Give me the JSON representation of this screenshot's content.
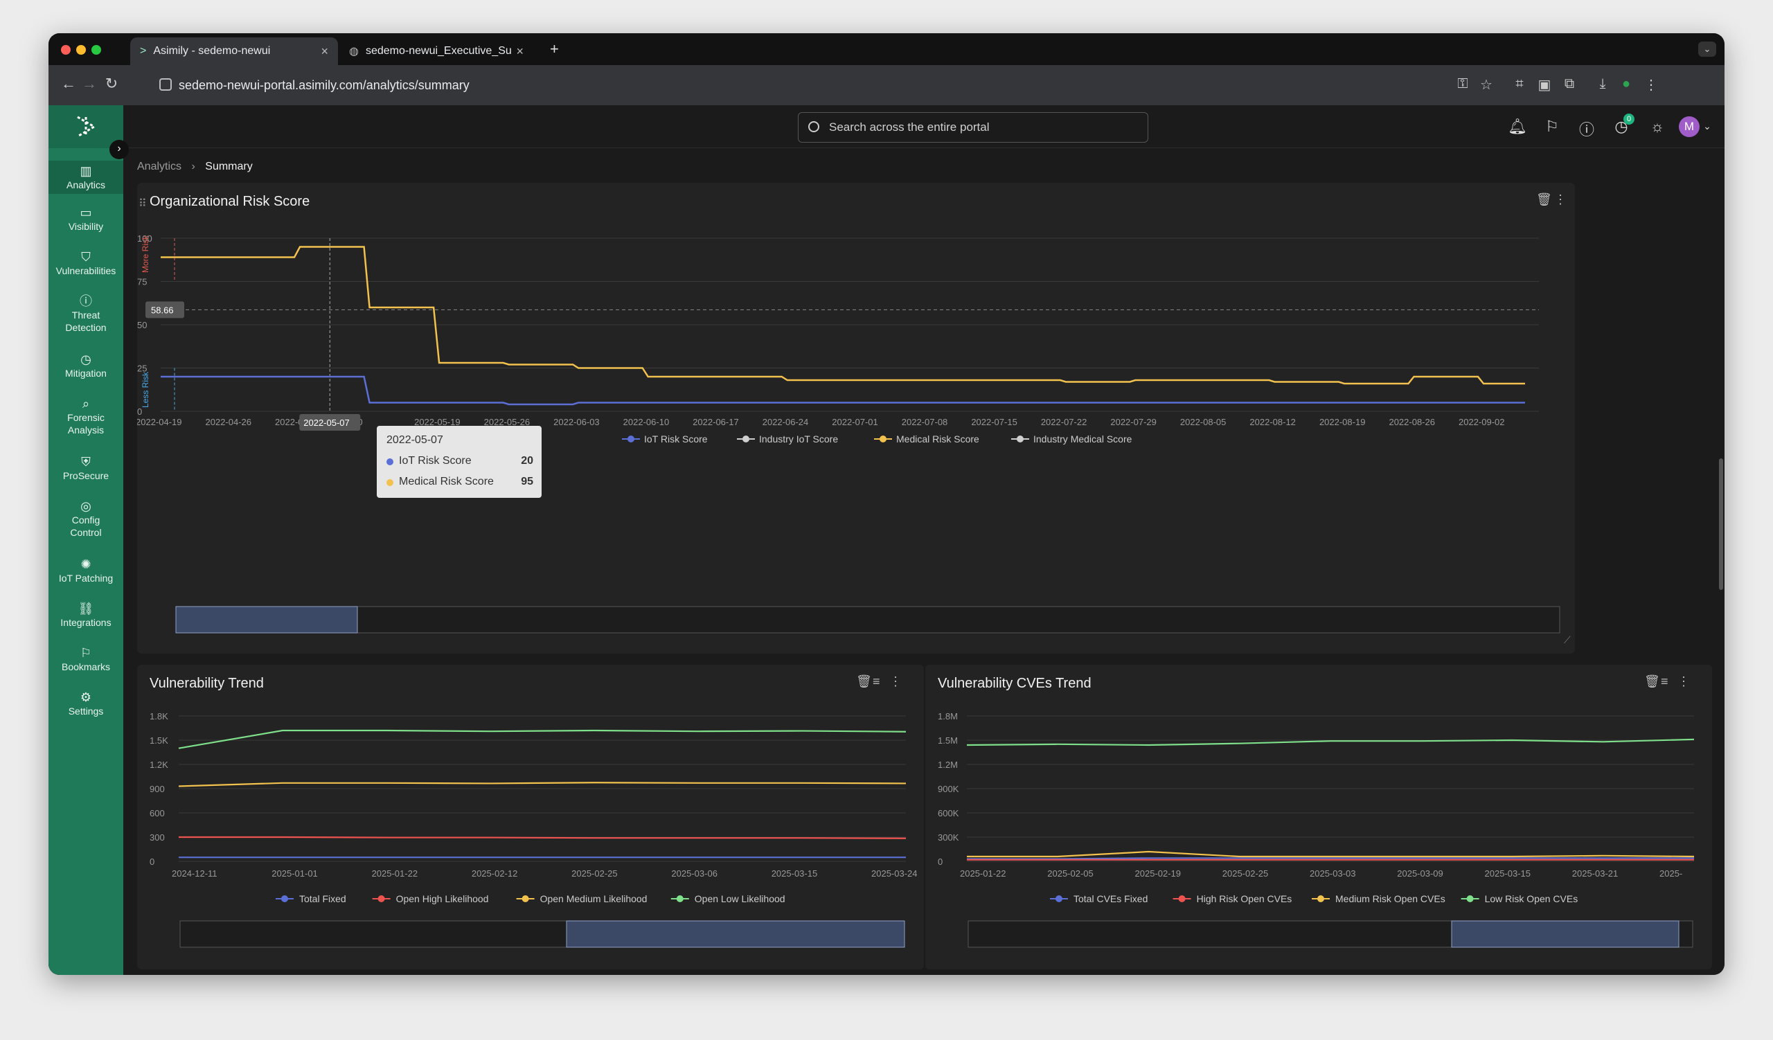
{
  "browser": {
    "tabs": [
      {
        "title": "Asimily - sedemo-newui",
        "active": true
      },
      {
        "title": "sedemo-newui_Executive_Su",
        "active": false
      }
    ],
    "new_tab": "+",
    "url": "sedemo-newui-portal.asimily.com/analytics/summary"
  },
  "app": {
    "search_placeholder": "Search across the entire portal",
    "notification_badge": "0",
    "avatar_initial": "M",
    "breadcrumb": {
      "parent": "Analytics",
      "current": "Summary"
    }
  },
  "sidebar": {
    "items": [
      {
        "label": "Analytics",
        "icon": "bar-chart-icon",
        "active": true
      },
      {
        "label": "Visibility",
        "icon": "monitor-icon"
      },
      {
        "label": "Vulnerabilities",
        "icon": "shield-icon"
      },
      {
        "label": "Threat Detection",
        "icon": "alert-icon"
      },
      {
        "label": "Mitigation",
        "icon": "clock-icon"
      },
      {
        "label": "Forensic Analysis",
        "icon": "search-icon"
      },
      {
        "label": "ProSecure",
        "icon": "shield-check-icon"
      },
      {
        "label": "Config Control",
        "icon": "cog-icon"
      },
      {
        "label": "IoT Patching",
        "icon": "patch-icon"
      },
      {
        "label": "Integrations",
        "icon": "link-icon"
      },
      {
        "label": "Bookmarks",
        "icon": "bookmark-icon"
      },
      {
        "label": "Settings",
        "icon": "gear-icon"
      }
    ]
  },
  "colors": {
    "accent": "#1f7a5a",
    "iot": "#5b6fd6",
    "industry": "#cfcfcf",
    "medical": "#f2c14e",
    "red": "#ef5350",
    "green": "#7ee08a"
  },
  "chart_data": [
    {
      "type": "line",
      "title": "Organizational Risk Score",
      "y_axis": {
        "ticks": [
          0,
          25,
          50,
          75,
          100
        ],
        "ylim": [
          0,
          100
        ],
        "upper_label": "More Risk",
        "lower_label": "Less Risk"
      },
      "reference_value": "58.66",
      "x": [
        "2022-04-19",
        "2022-04-26",
        "2022-05-03",
        "2022-05-10",
        "2022-05-19",
        "2022-05-26",
        "2022-06-03",
        "2022-06-10",
        "2022-06-17",
        "2022-06-24",
        "2022-07-01",
        "2022-07-08",
        "2022-07-15",
        "2022-07-22",
        "2022-07-29",
        "2022-08-05",
        "2022-08-12",
        "2022-08-19",
        "2022-08-26",
        "2022-09-02"
      ],
      "x_tick_labels": [
        "2022-04-19",
        "2022-04-26",
        "2022-0",
        "5-10",
        "2022-05-19",
        "2022-05-26",
        "2022-06-03",
        "2022-06-10",
        "2022-06-17",
        "2022-06-24",
        "2022-07-01",
        "2022-07-08",
        "2022-07-15",
        "2022-07-22",
        "2022-07-29",
        "2022-08-05",
        "2022-08-12",
        "2022-08-19",
        "2022-08-26",
        "2022-09-02"
      ],
      "highlight_x": "2022-05-07",
      "series": [
        {
          "name": "IoT Risk Score",
          "values": [
            20,
            20,
            20,
            5,
            5,
            4,
            5,
            5,
            5,
            5,
            5,
            5,
            5,
            5,
            5,
            5,
            5,
            5,
            5,
            5
          ]
        },
        {
          "name": "Industry IoT Score",
          "values": []
        },
        {
          "name": "Medical Risk Score",
          "values": [
            89,
            89,
            95,
            60,
            28,
            27,
            25,
            20,
            20,
            18,
            18,
            18,
            18,
            17,
            18,
            18,
            17,
            16,
            20,
            16
          ]
        },
        {
          "name": "Industry Medical Score",
          "values": []
        }
      ],
      "tooltip": {
        "date": "2022-05-07",
        "rows": [
          {
            "name": "IoT Risk Score",
            "value": "20"
          },
          {
            "name": "Medical Risk Score",
            "value": "95"
          }
        ]
      }
    },
    {
      "type": "line",
      "title": "Vulnerability Trend",
      "y_ticks": [
        "0",
        "300",
        "600",
        "900",
        "1.2K",
        "1.5K",
        "1.8K"
      ],
      "ylim": [
        0,
        1800
      ],
      "x_tick_labels": [
        "2024-12-11",
        "2025-01-01",
        "2025-01-22",
        "2025-02-12",
        "2025-02-25",
        "2025-03-06",
        "2025-03-15",
        "2025-03-24"
      ],
      "series": [
        {
          "name": "Total Fixed",
          "values": [
            50,
            50,
            50,
            50,
            50,
            50,
            50,
            50
          ]
        },
        {
          "name": "Open High Likelihood",
          "values": [
            300,
            300,
            295,
            295,
            290,
            290,
            290,
            285
          ]
        },
        {
          "name": "Open Medium Likelihood",
          "values": [
            930,
            970,
            970,
            965,
            975,
            970,
            970,
            965
          ]
        },
        {
          "name": "Open Low Likelihood",
          "values": [
            1400,
            1620,
            1620,
            1610,
            1620,
            1610,
            1615,
            1605
          ]
        }
      ]
    },
    {
      "type": "line",
      "title": "Vulnerability CVEs Trend",
      "y_ticks": [
        "0",
        "300K",
        "600K",
        "900K",
        "1.2M",
        "1.5M",
        "1.8M"
      ],
      "ylim": [
        0,
        1800000
      ],
      "x_tick_labels": [
        "2025-01-22",
        "2025-02-05",
        "2025-02-19",
        "2025-02-25",
        "2025-03-03",
        "2025-03-09",
        "2025-03-15",
        "2025-03-21",
        "2025-"
      ],
      "series": [
        {
          "name": "Total CVEs Fixed",
          "values": [
            30000,
            30000,
            40000,
            40000,
            40000,
            40000,
            40000,
            40000,
            40000
          ]
        },
        {
          "name": "High Risk Open CVEs",
          "values": [
            20000,
            20000,
            20000,
            20000,
            20000,
            20000,
            20000,
            20000,
            20000
          ]
        },
        {
          "name": "Medium Risk Open CVEs",
          "values": [
            60000,
            60000,
            120000,
            60000,
            60000,
            60000,
            60000,
            70000,
            60000
          ]
        },
        {
          "name": "Low Risk Open CVEs",
          "values": [
            1440000,
            1450000,
            1440000,
            1460000,
            1490000,
            1490000,
            1500000,
            1480000,
            1510000
          ]
        }
      ]
    }
  ]
}
